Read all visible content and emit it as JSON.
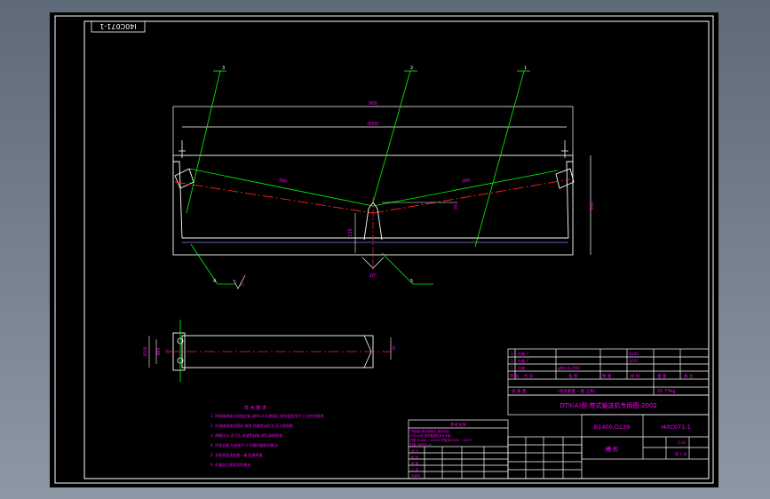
{
  "drawing": {
    "sheet_code": "I40C071-1",
    "callouts": [
      "1",
      "2",
      "3",
      "4",
      "5"
    ],
    "dimensions": {
      "overall_width": "900",
      "inner_width": "(600)",
      "trough_length_left": "380",
      "trough_length_right": "380",
      "height": "340",
      "angle": "30°",
      "center_angle": "20°",
      "center_height": "125",
      "small_dim": "35",
      "roughness": "25",
      "end_view_dims": [
        "Ø108",
        "Ø89",
        "20",
        "60"
      ]
    },
    "notes": {
      "title": "技 术 要 求",
      "lines": [
        "1. 托辊轴承座与托辊支架 φ89×4.0 焊接后 按托辊类型尺寸 应符合要求",
        "2. 托辊轴承选用密封 轴承 托辊转动灵活 无卡阻现象",
        "3. 焊缝均匀 无气孔 夹渣等缺陷 焊后清除焊渣",
        "4. 托辊长度 与安装尺寸 托辊外圆径向跳动",
        "5. 支架表面涂底漆一道 面漆两道",
        "6. 外露加工表面涂防锈油"
      ]
    },
    "title_block": {
      "parts_rows": [
        [
          "3",
          "托辊-7",
          "",
          "Q235",
          "",
          ""
        ],
        [
          "2",
          "托辊-7",
          "",
          "Q235",
          "",
          ""
        ],
        [
          "1",
          "托辊",
          "φ89×4×950",
          "",
          "",
          ""
        ]
      ],
      "header": [
        "序 号",
        "代 号",
        "名 称",
        "数 量",
        "材 料",
        "重 量",
        "备 注"
      ],
      "total_label": "总 重 量",
      "total_value": "31.73kg",
      "assembly_note": "(单件重量 一套 之和)",
      "main_title": "DTII(A)型 带式输送机专用图-2002",
      "spec": "B1400,D139",
      "drawing_no": "I40C071-1",
      "part_name": "槽 形",
      "unit": "1:10",
      "sheet": "第 1 张",
      "reference_header": "参考文件",
      "reference_lines": [
        "托辊组合基本参数见 相关标准",
        "DTII(A)型 带式输送机设计手册",
        "托辊 B1000 ~ B1400 托辊组 D108 ~ D159",
        "托辊 GB990-91"
      ],
      "sign_rows": [
        "设 计",
        "校 对",
        "审 核",
        "工 艺",
        "标准化",
        "批 准"
      ]
    }
  },
  "colors": {
    "background": "#000000",
    "border": "#ffffff",
    "leader": "#00ff00",
    "centerline": "#ff2020",
    "text": "#ff00ff",
    "dimension": "#ff00ff",
    "belt": "#ffffff"
  }
}
